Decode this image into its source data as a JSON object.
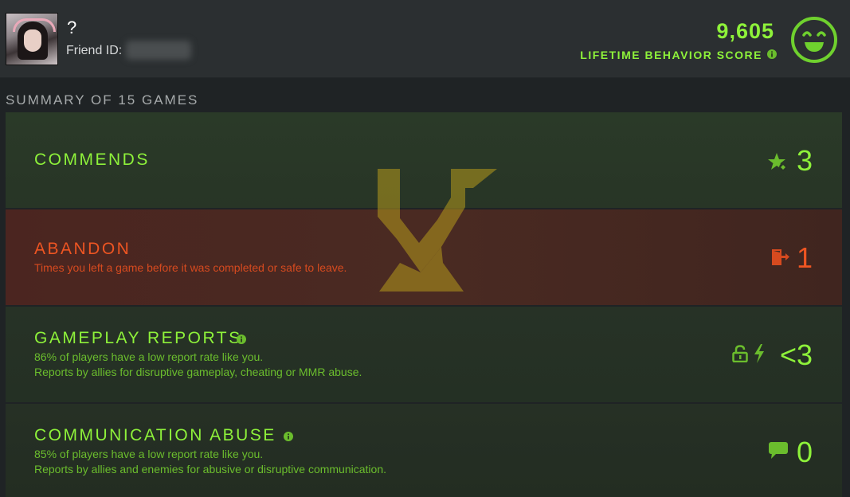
{
  "header": {
    "username": "?",
    "friend_id_label": "Friend ID:",
    "score_value": "9,605",
    "score_label": "LIFETIME BEHAVIOR SCORE"
  },
  "summary": {
    "title": "SUMMARY OF 15 GAMES"
  },
  "rows": {
    "commends": {
      "title": "COMMENDS",
      "value": "3",
      "icon": "star-commend-icon"
    },
    "abandon": {
      "title": "ABANDON",
      "description": "Times you left a game before it was completed or safe to leave.",
      "value": "1",
      "icon": "exit-door-icon"
    },
    "gameplay": {
      "title": "GAMEPLAY REPORTS",
      "description_1": "86% of players have a low report rate like you.",
      "description_2": "Reports by allies for disruptive gameplay, cheating or MMR abuse.",
      "value": "<3",
      "icons": [
        "lock-icon",
        "lightning-icon"
      ]
    },
    "communication": {
      "title": "COMMUNICATION ABUSE",
      "description_1": "85% of players have a low report rate like you.",
      "description_2": "Reports by allies and enemies for abusive or disruptive communication.",
      "value": "0",
      "icon": "chat-bubble-icon"
    }
  },
  "colors": {
    "accent_green": "#8ef23a",
    "accent_orange": "#ee5522",
    "background": "#1f2325"
  }
}
